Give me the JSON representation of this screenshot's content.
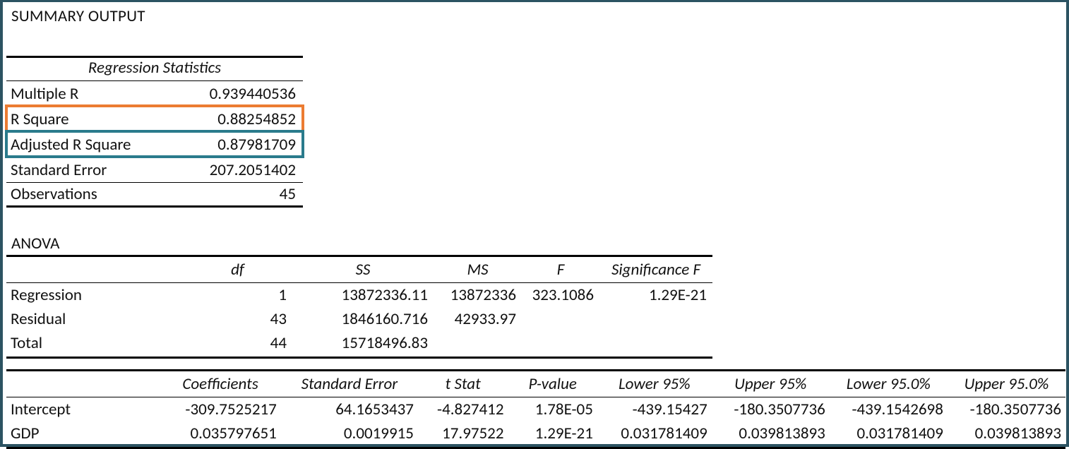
{
  "title": "SUMMARY OUTPUT",
  "regstats": {
    "heading": "Regression Statistics",
    "rows": [
      {
        "label": "Multiple R",
        "value": "0.939440536"
      },
      {
        "label": "R Square",
        "value": "0.88254852"
      },
      {
        "label": "Adjusted R Square",
        "value": "0.87981709"
      },
      {
        "label": "Standard Error",
        "value": "207.2051402"
      },
      {
        "label": "Observations",
        "value": "45"
      }
    ]
  },
  "anova": {
    "heading": "ANOVA",
    "headers": {
      "df": "df",
      "ss": "SS",
      "ms": "MS",
      "f": "F",
      "sigf": "Significance F"
    },
    "rows": [
      {
        "name": "Regression",
        "df": "1",
        "ss": "13872336.11",
        "ms": "13872336",
        "f": "323.1086",
        "sigf": "1.29E-21"
      },
      {
        "name": "Residual",
        "df": "43",
        "ss": "1846160.716",
        "ms": "42933.97",
        "f": "",
        "sigf": ""
      },
      {
        "name": "Total",
        "df": "44",
        "ss": "15718496.83",
        "ms": "",
        "f": "",
        "sigf": ""
      }
    ]
  },
  "coef": {
    "headers": {
      "coef": "Coefficients",
      "se": "Standard Error",
      "t": "t Stat",
      "p": "P-value",
      "l95": "Lower 95%",
      "u95": "Upper 95%",
      "l950": "Lower 95.0%",
      "u950": "Upper 95.0%"
    },
    "rows": [
      {
        "name": "Intercept",
        "coef": "-309.7525217",
        "se": "64.1653437",
        "t": "-4.827412",
        "p": "1.78E-05",
        "l95": "-439.15427",
        "u95": "-180.3507736",
        "l950": "-439.1542698",
        "u950": "-180.3507736"
      },
      {
        "name": "GDP",
        "coef": "0.035797651",
        "se": "0.0019915",
        "t": "17.97522",
        "p": "1.29E-21",
        "l95": "0.031781409",
        "u95": "0.039813893",
        "l950": "0.031781409",
        "u950": "0.039813893"
      }
    ]
  },
  "highlights": {
    "orange_index": 1,
    "teal_index": 2
  }
}
